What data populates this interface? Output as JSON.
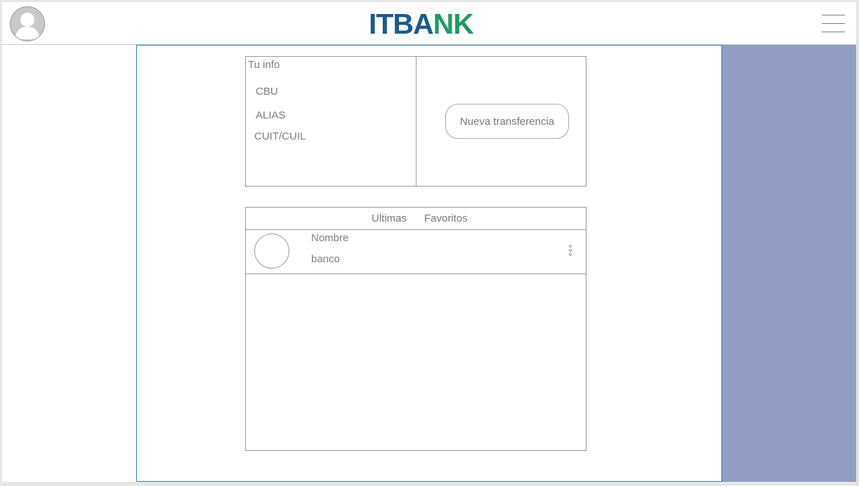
{
  "header": {
    "logo_part1": "ITBA",
    "logo_part2": "NK"
  },
  "info": {
    "title": "Tu info",
    "fields": [
      "CBU",
      "ALIAS",
      "CUIT/CUIL"
    ],
    "transfer_button": "Nueva transferencia"
  },
  "contacts": {
    "tabs": [
      "Ultimas",
      "Favoritos"
    ],
    "rows": [
      {
        "name": "Nombre",
        "bank": "banco"
      }
    ]
  },
  "colors": {
    "logo_blue": "#1a5b8c",
    "logo_green": "#1f9a63",
    "side_panel": "#919dc3",
    "content_border": "#3b78c0"
  },
  "icons": {
    "avatar": "user-avatar-icon",
    "menu": "hamburger-menu-icon",
    "row_more": "kebab-menu-icon"
  }
}
